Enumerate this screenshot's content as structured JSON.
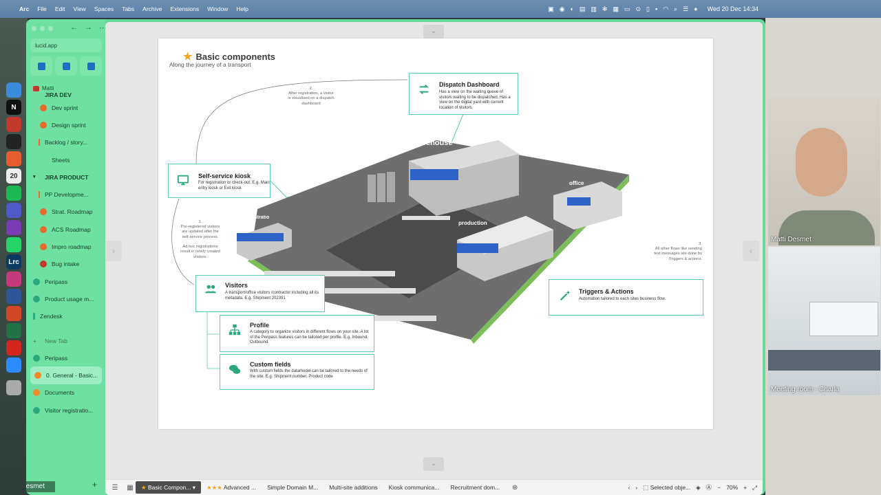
{
  "menubar": {
    "app_name": "Arc",
    "items": [
      "File",
      "Edit",
      "View",
      "Spaces",
      "Tabs",
      "Archive",
      "Extensions",
      "Window",
      "Help"
    ],
    "clock": "Wed 20 Dec  14:34"
  },
  "sidebar": {
    "url": "lucid.app",
    "section_label": "Matti",
    "items": [
      {
        "label": "JIRA DEV"
      },
      {
        "label": "Dev sprint"
      },
      {
        "label": "Design sprint"
      },
      {
        "label": "Backlog / story..."
      },
      {
        "label": "Sheets"
      },
      {
        "label": "JIRA PRODUCT"
      },
      {
        "label": "PP Developme..."
      },
      {
        "label": "Strat. Roadmap"
      },
      {
        "label": "ACS Roadmap"
      },
      {
        "label": "Impro roadmap"
      },
      {
        "label": "Bug intake"
      },
      {
        "label": "Peripass"
      },
      {
        "label": "Product usage m..."
      },
      {
        "label": "Zendesk"
      },
      {
        "label": "New Tab"
      },
      {
        "label": "Peripass"
      },
      {
        "label": "0. General - Basic..."
      },
      {
        "label": "Documents"
      },
      {
        "label": "Visitor registratio..."
      }
    ],
    "user_label": "Matti Desmet"
  },
  "slide": {
    "title": "Basic components",
    "subtitle": "Along the journey of a transport",
    "dispatch": {
      "title": "Dispatch Dashboard",
      "desc": "Has a view on the waiting queue of visitors waiting to be dispatched. Has a view on the digital yard with current location of visitors."
    },
    "kiosk": {
      "title": "Self-service kiosk",
      "desc": "For registration or check-out. E.g. Main entry kiosk or Exit kiosk"
    },
    "visitors": {
      "title": "Visitors",
      "desc": "A transport/office visitors /contractor including all its metadata. E.g. Shipment 202391"
    },
    "profile": {
      "title": "Profile",
      "desc": "A category to organize visitors in different flows on your site. A lot of the Peripass features can be tailored per profile.  E.g. Inbound, Outbound"
    },
    "custom": {
      "title": "Custom fields",
      "desc": "With custom fields the datamodel can be tailored to the needs of the site. E.g. Shipment number, Product code"
    },
    "triggers": {
      "title": "Triggers & Actions",
      "desc": "Automation tailored to each sites business flow."
    },
    "note1": "1.\nPre-registered visitors are updated after the self-service process.\n\nAd hoc registrations result in newly created visitors.",
    "note2": "2.\nAfter registration, a visitor is visualised on a dispatch dashboard",
    "note3": "3.\nAll other flows like sending text messages are done by Triggers & actions.",
    "buildings": {
      "warehouse": "warehouse",
      "office": "office",
      "production": "production",
      "self": "self registratio"
    }
  },
  "bottombar": {
    "tabs": [
      "Basic Compon...",
      "Advanced ...",
      "Simple Domain M...",
      "Multi-site additions",
      "Kiosk communica...",
      "Recruitment dom..."
    ],
    "selected": "Selected obje...",
    "zoom": "70%"
  },
  "video": {
    "tile1": "Matti Desmet",
    "tile2": "Meeting room - Charla"
  },
  "colors": {
    "accent": "#5ec9b3",
    "arc": "#6ee0a2",
    "label_blue": "#2f62c7"
  }
}
